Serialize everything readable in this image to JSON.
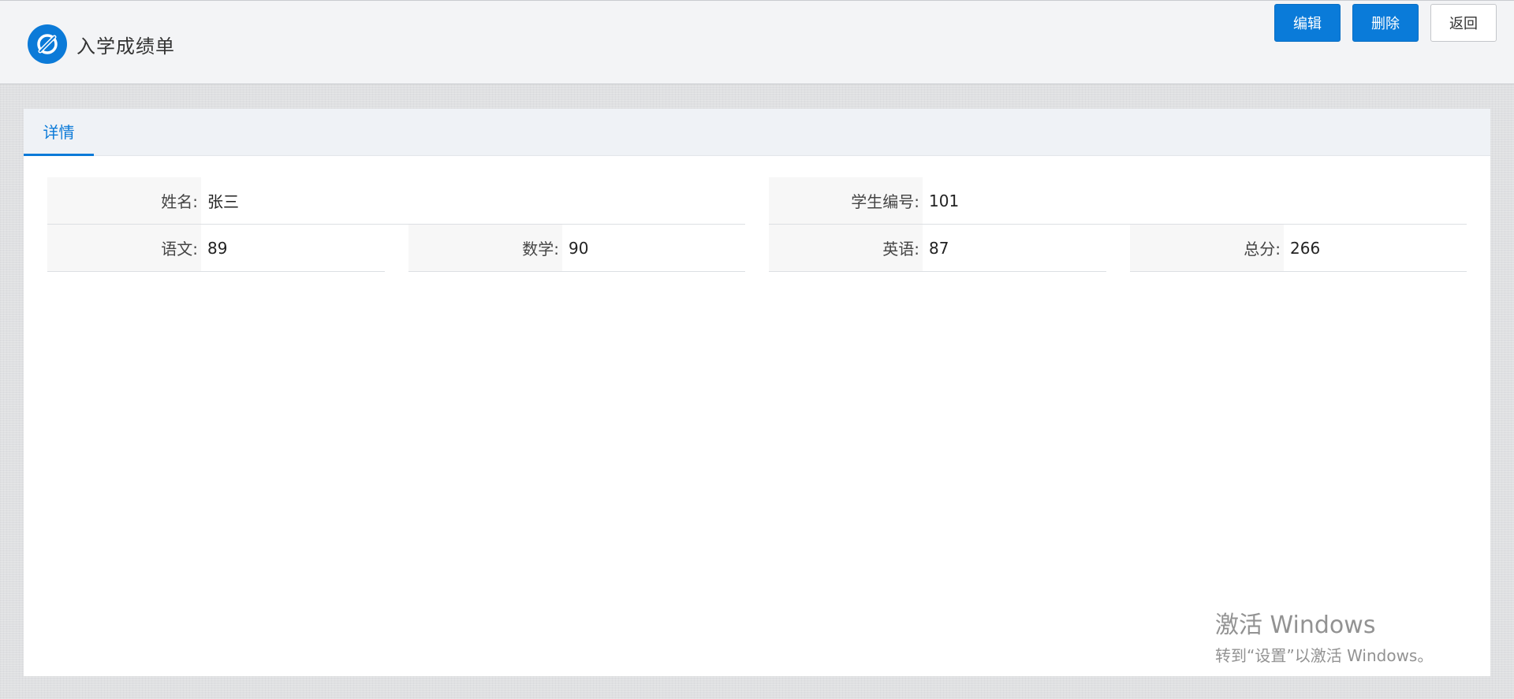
{
  "app": {
    "title": "入学成绩单",
    "brand_color": "#0b7ad8"
  },
  "toolbar": {
    "edit_label": "编辑",
    "delete_label": "删除",
    "back_label": "返回"
  },
  "tabs": [
    {
      "label": "详情",
      "active": true
    }
  ],
  "details": {
    "name": {
      "label": "姓名:",
      "value": "张三"
    },
    "student_id": {
      "label": "学生编号:",
      "value": "101"
    },
    "chinese": {
      "label": "语文:",
      "value": "89"
    },
    "math": {
      "label": "数学:",
      "value": "90"
    },
    "english": {
      "label": "英语:",
      "value": "87"
    },
    "total": {
      "label": "总分:",
      "value": "266"
    }
  },
  "watermark": {
    "title": "激活 Windows",
    "subtitle": "转到“设置”以激活 Windows。"
  }
}
